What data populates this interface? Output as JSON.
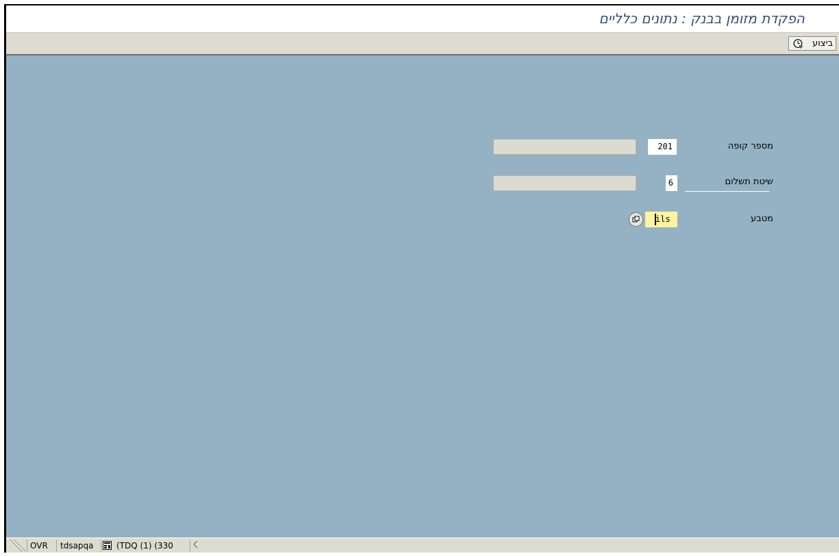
{
  "window": {
    "title": "הפקדת מזומן בבנק : נתונים כלליים"
  },
  "toolbar": {
    "execute_label": "ביצוע",
    "execute_icon": "execute-clock-icon"
  },
  "form": {
    "cash_register": {
      "label": "מספר קופה",
      "value": "201",
      "description": ""
    },
    "payment_method": {
      "label": "שיטת תשלום",
      "value": "6",
      "description": ""
    },
    "currency": {
      "label": "מטבע",
      "value": "ils",
      "help_icon": "value-help-icon"
    }
  },
  "status_bar": {
    "mode": "OVR",
    "server": "tdsapqa",
    "system": "(TDQ (1) (330"
  },
  "colors": {
    "title_text": "#30507a",
    "toolbar_bg": "#dedcd1",
    "work_area_bg": "#95b1c4",
    "input_bg": "#ffffff",
    "focused_input_bg": "#fdf3a0",
    "description_bg": "#dcdbd0"
  }
}
